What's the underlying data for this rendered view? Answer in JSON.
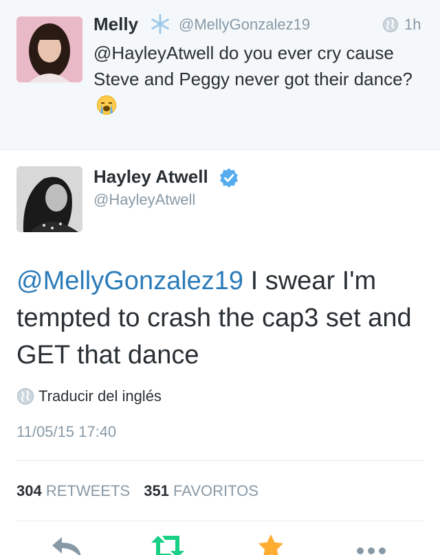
{
  "parent_tweet": {
    "name": "Melly",
    "handle": "@MellyGonzalez19",
    "time": "1h",
    "text": "@HayleyAtwell do you ever cry cause Steve and Peggy never got their dance?",
    "icons": [
      "snowflake-emoji",
      "globe-icon",
      "crying-face-emoji"
    ]
  },
  "tweet": {
    "name": "Hayley Atwell",
    "handle": "@HayleyAtwell",
    "mention": "@MellyGonzalez19",
    "text": " I swear I'm tempted to crash the cap3 set and GET that dance",
    "translate_label": "Traducir del inglés",
    "datetime": "11/05/15 17:40",
    "retweets_count": "304",
    "retweets_label": "RETWEETS",
    "favorites_count": "351",
    "favorites_label": "FAVORITOS"
  },
  "actions": [
    "reply-icon",
    "retweet-icon",
    "favorite-icon",
    "more-icon"
  ],
  "colors": {
    "link": "#2b7bb9",
    "muted": "#8899a6",
    "text": "#292f33",
    "verified": "#55acee",
    "retweet": "#19cf86",
    "favorite": "#ffac33",
    "parent_bg": "#f5f8fa"
  }
}
